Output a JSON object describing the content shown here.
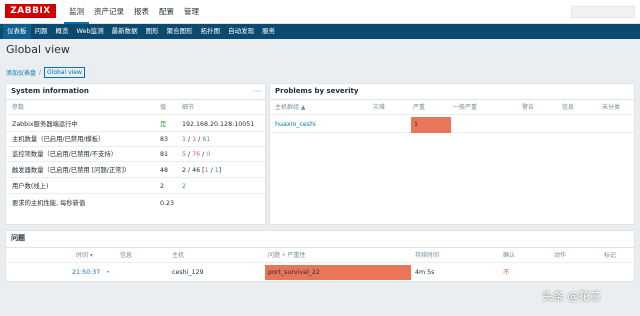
{
  "logo": {
    "text": "ZABBIX"
  },
  "main_menu": [
    "监测",
    "资产记录",
    "报表",
    "配置",
    "管理"
  ],
  "sub_menu": [
    "仪表板",
    "问题",
    "概览",
    "Web监测",
    "最新数据",
    "图形",
    "聚合图形",
    "拓扑图",
    "自动发现",
    "服务"
  ],
  "page_title": "Global view",
  "breadcrumb": {
    "parent": "添加仪表盘",
    "separator": "/",
    "current": "Global view"
  },
  "system_info": {
    "title": "System information",
    "menu_icon": "···",
    "headers": [
      "参数",
      "值",
      "细节"
    ],
    "rows": [
      {
        "param": "Zabbix服务器端运行中",
        "value": "是",
        "detail": "192.168.20.128:10051"
      },
      {
        "param": "主机数量（已启用/已禁用/模板）",
        "value": "83",
        "detail_parts": [
          "1",
          " / ",
          "1",
          " / ",
          "81"
        ]
      },
      {
        "param": "监控项数量（已启用/已禁用/不支持）",
        "value": "81",
        "detail_parts": [
          "5",
          " / ",
          "76",
          " / ",
          "0"
        ]
      },
      {
        "param": "触发器数量（已启用/已禁用 [问题/正常]）",
        "value": "48",
        "detail_parts": [
          "2 / 46 [",
          "1",
          " / ",
          "1",
          "]"
        ]
      },
      {
        "param": "用户数(线上)",
        "value": "2",
        "detail": "2"
      },
      {
        "param": "要求的主机性能, 每秒新值",
        "value": "0.23",
        "detail": ""
      }
    ]
  },
  "problems_by_severity": {
    "title": "Problems by severity",
    "headers": [
      "主机群组 ▲",
      "灾难",
      "严重",
      "一般严重",
      "警告",
      "信息",
      "未分类"
    ],
    "rows": [
      {
        "group": "huaxin_ceshi",
        "high": "1"
      }
    ],
    "colors": {
      "high": "#e97659"
    }
  },
  "problems": {
    "title": "问题",
    "headers": [
      "时间 ▾",
      "信息",
      "主机",
      "问题 • 严重性",
      "持续时间",
      "确认",
      "动作",
      "标记"
    ],
    "rows": [
      {
        "time": "21:50:37",
        "host": "ceshi_129",
        "problem": "port_survival_22",
        "duration": "4m 5s",
        "ack": "不"
      }
    ]
  },
  "search": {
    "placeholder": ""
  },
  "watermark": "头条 @花芯"
}
